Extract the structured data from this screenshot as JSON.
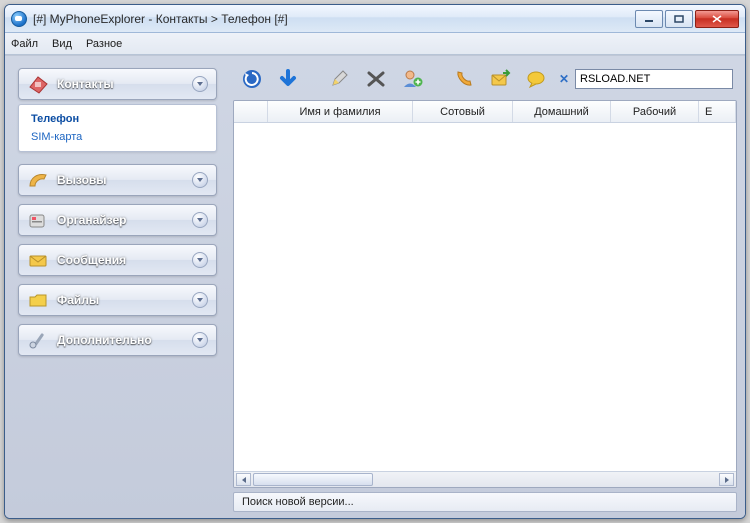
{
  "window": {
    "title": "[#] MyPhoneExplorer -  Контакты > Телефон [#]"
  },
  "menu": {
    "file": "Файл",
    "view": "Вид",
    "misc": "Разное"
  },
  "sidebar": {
    "items": [
      {
        "label": "Контакты",
        "icon": "contacts-icon",
        "expanded": true
      },
      {
        "label": "Вызовы",
        "icon": "calls-icon"
      },
      {
        "label": "Органайзер",
        "icon": "organizer-icon"
      },
      {
        "label": "Сообщения",
        "icon": "messages-icon"
      },
      {
        "label": "Файлы",
        "icon": "files-icon"
      },
      {
        "label": "Дополнительно",
        "icon": "extras-icon"
      }
    ],
    "subitems": {
      "phone": "Телефон",
      "sim": "SIM-карта"
    }
  },
  "toolbar": {
    "refresh_icon": "refresh-icon",
    "download_icon": "download-icon",
    "edit_icon": "edit-icon",
    "delete_icon": "delete-icon",
    "adduser_icon": "add-user-icon",
    "call_icon": "call-icon",
    "send_icon": "send-icon",
    "chat_icon": "chat-icon"
  },
  "search": {
    "value": "RSLOAD.NET"
  },
  "columns": {
    "name": "Имя и фамилия",
    "mobile": "Сотовый",
    "home": "Домашний",
    "work": "Рабочий",
    "extra": "E"
  },
  "status": {
    "text": "Поиск новой версии..."
  }
}
